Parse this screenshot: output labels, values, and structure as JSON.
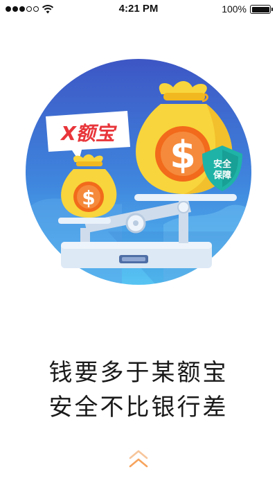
{
  "status_bar": {
    "time": "4:21 PM",
    "battery": "100%",
    "signal_dots_filled": 3,
    "signal_dots_total": 5
  },
  "illustration": {
    "bubble_text": "X额宝",
    "dollar_sign": "$",
    "shield_line1": "安全",
    "shield_line2": "保障"
  },
  "slogan": {
    "line1": "钱要多于某额宝",
    "line2": "安全不比银行差"
  },
  "colors": {
    "circle_top": "#3e5fc9",
    "circle_bottom": "#4fb8ef",
    "bag": "#f8d53c",
    "coin": "#f26a1b",
    "shield": "#1fb3a7",
    "bubble_text": "#e8353a",
    "swipe_arrow": "#f7a35c"
  },
  "icons": [
    "wifi-icon",
    "battery-icon",
    "shield-icon",
    "chevron-up-icon"
  ]
}
